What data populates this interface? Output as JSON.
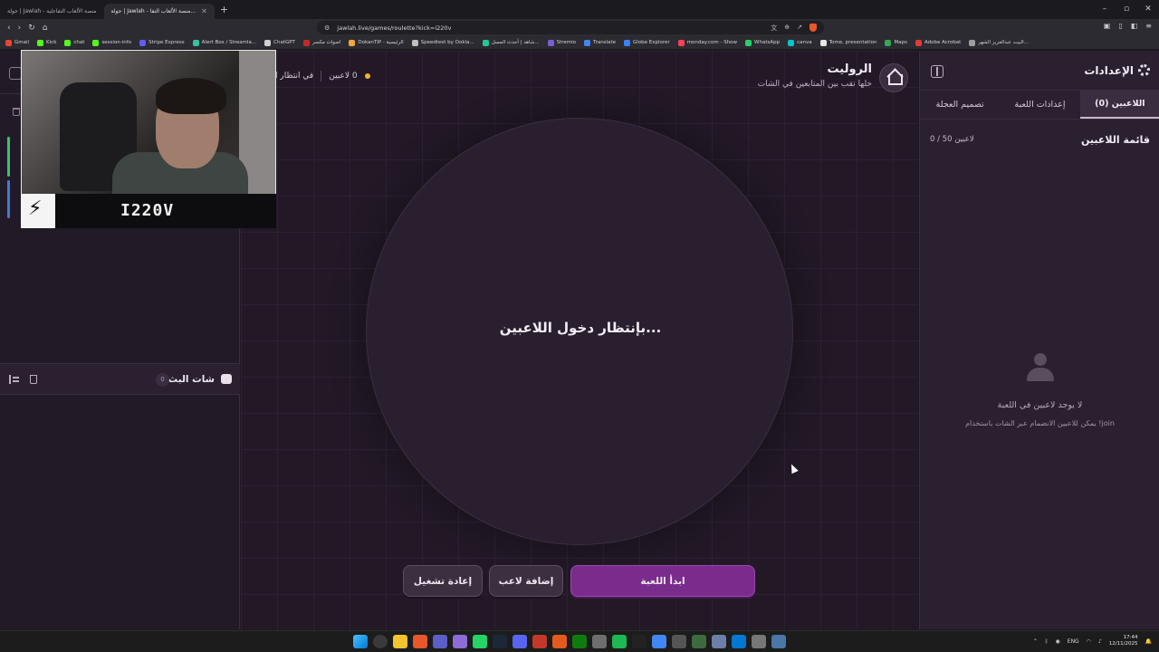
{
  "browser": {
    "tabs": [
      {
        "label": "جولة | Jawlah - منصة الألعاب التفاعلية",
        "active": false
      },
      {
        "label": "جولة | Jawlah - منصة الألعاب التفا...",
        "active": true
      }
    ],
    "new_tab": "+",
    "url": "jawlah.live/games/roulette?kick=i220v",
    "bookmarks": [
      "Gmail",
      "Kick",
      "chat",
      "session-info",
      "Stripe Express",
      "Alert Box / Streamla...",
      "ChatGPT",
      "اصوات مكسر",
      "DokanTIP - الرئيسية",
      "Speedtest by Ookla...",
      "شاهد | أحدث المسل...",
      "Stremio",
      "Translate",
      "Globe Explorer",
      "monday.com - Show",
      "WhatsApp",
      "canva",
      "Tome, presentation",
      "Maps",
      "Adobe Acrobat",
      "البيت عبدالعزيز الشهر..."
    ]
  },
  "webcam": {
    "name": "I220V"
  },
  "game": {
    "title": "الروليت",
    "subtitle": "خلها تقب بين المتابعين في الشات",
    "players_status": "0 لاعبين",
    "waiting_status": "في انتظار ا",
    "wheel_text": "بإنتظار دخول اللاعبين...",
    "buttons": {
      "start": "ابدأ اللعبة",
      "add_player": "إضافة لاعب",
      "reset": "إعادة تشغيل"
    }
  },
  "chat": {
    "title": "شات البث",
    "count": "0"
  },
  "settings": {
    "title": "الإعدادات",
    "tabs": [
      {
        "label": "اللاعبين (0)",
        "active": true
      },
      {
        "label": "إعدادات اللعبة",
        "active": false
      },
      {
        "label": "تصميم العجلة",
        "active": false
      }
    ],
    "list_title": "قائمة اللاعبين",
    "list_count": "0 / 50 لاعبين",
    "empty_title": "لا يوجد لاعبين في اللعبة",
    "empty_subtitle": "يمكن للاعبين الانضمام عبر الشات باستخدام !join"
  },
  "taskbar": {
    "lang": "ENG",
    "time": "17:44",
    "date": "12/11/2025"
  },
  "colors": {
    "accent": "#7a2c8d",
    "status_dot": "#f1b52c",
    "background": "#1f1623"
  }
}
